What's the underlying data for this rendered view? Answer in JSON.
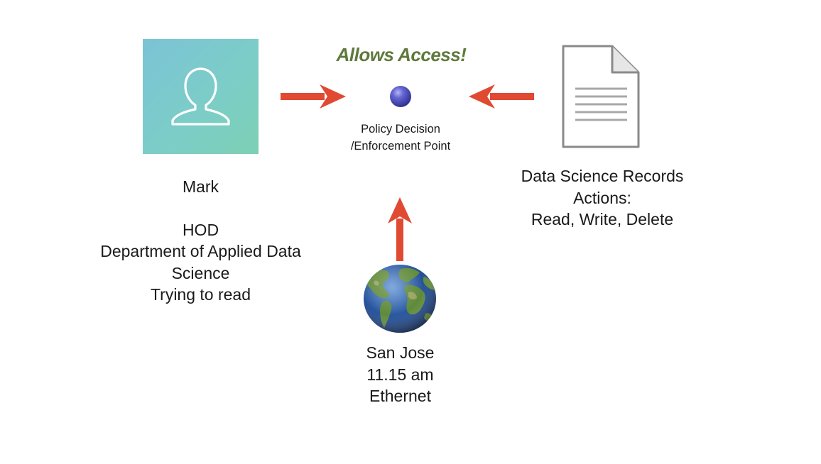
{
  "decision": {
    "result_text": "Allows Access!",
    "pdp_label_lines": [
      "Policy Decision",
      "/Enforcement Point"
    ]
  },
  "subject": {
    "icon": "person-icon",
    "name": "Mark",
    "attribute_lines": [
      "HOD",
      "Department of Applied Data",
      "Science",
      "Trying to read"
    ]
  },
  "resource": {
    "icon": "document-icon",
    "lines": [
      "Data Science Records",
      "Actions:",
      "Read, Write, Delete"
    ]
  },
  "environment": {
    "icon": "globe-icon",
    "lines": [
      "San Jose",
      "11.15 am",
      "Ethernet"
    ]
  },
  "colors": {
    "arrow": "#e04a33",
    "result_text": "#5e7a3b",
    "sphere": "#4a4bbd",
    "card_gradient_start": "#7cc3d6",
    "card_gradient_end": "#7dd0b4"
  }
}
